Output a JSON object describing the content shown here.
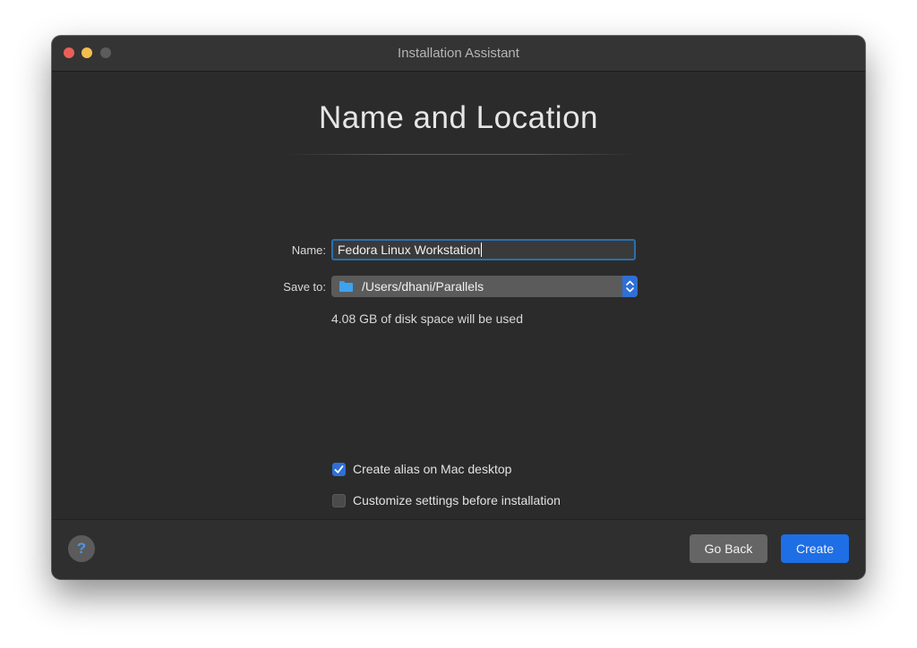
{
  "window": {
    "title": "Installation Assistant"
  },
  "page": {
    "heading": "Name and Location"
  },
  "form": {
    "name_label": "Name:",
    "name_value": "Fedora Linux Workstation",
    "save_label": "Save to:",
    "save_path": "/Users/dhani/Parallels",
    "disk_usage": "4.08 GB of disk space will be used"
  },
  "options": [
    {
      "label": "Create alias on Mac desktop",
      "checked": true
    },
    {
      "label": "Customize settings before installation",
      "checked": false
    }
  ],
  "footer": {
    "help_label": "?",
    "back_label": "Go Back",
    "create_label": "Create"
  },
  "icons": {
    "window_controls": [
      "close-icon",
      "minimize-icon",
      "maximize-icon"
    ],
    "folder": "folder-icon",
    "stepper": "updown-chevron-icon",
    "checkmark": "checkmark-icon"
  },
  "colors": {
    "accent": "#1e6ee5",
    "window_bg": "#2b2b2b",
    "close": "#ec5f57",
    "minimize": "#f4bd4f"
  }
}
